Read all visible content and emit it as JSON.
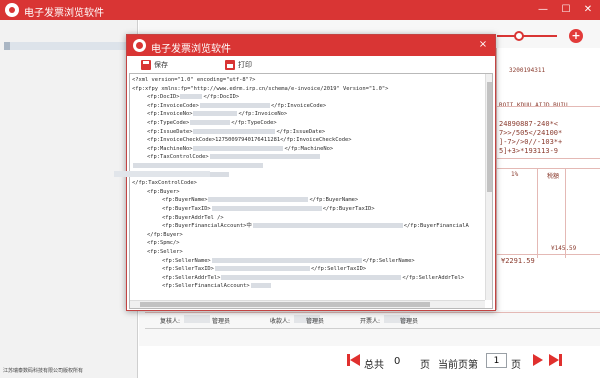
{
  "app": {
    "title": "电子发票浏览软件",
    "footer": "江苏瑞泰数码科技有限公司版权所有"
  },
  "window_controls": {
    "minimize": "—",
    "maximize": "☐",
    "close": "✕"
  },
  "zoom": {
    "plus": "+"
  },
  "invoice": {
    "lines": [
      "3200194311",
      "ROII KDUU AIJD BUIU",
      "24890887-240*<",
      "7>>/505</24100*",
      "]-7>/>0//-103*+",
      "5]+3>*193113-9",
      "",
      "¥145.59",
      "¥2291.59"
    ],
    "col_labels": [
      "1%",
      "税額"
    ]
  },
  "bottom_cells": [
    {
      "label": "复核人:",
      "value": "管理员"
    },
    {
      "label": "收款人:",
      "value": "管理员"
    },
    {
      "label": "开票人:",
      "value": "管理员"
    }
  ],
  "pager": {
    "total_label": "总共",
    "total": "0",
    "page_unit": "页",
    "current_label": "当前页第",
    "current_page": "1",
    "current_unit": "页"
  },
  "dialog": {
    "title": "电子发票浏览软件",
    "close": "×",
    "toolbar": {
      "save": "保存",
      "print": "打印"
    },
    "xml_lines": [
      {
        "indent": 0,
        "text": "<?xml version=\"1.0\" encoding=\"utf-8\"?>"
      },
      {
        "indent": 0,
        "text": "<fp:xfpy xmlns:fp=\"http://www.edrm.irp.cn/schema/e-invoice/2019\" Version=\"1.0\">"
      },
      {
        "indent": 1,
        "text": "<fp:DocID>",
        "tail": "</fp:DocID>",
        "blur": 22
      },
      {
        "indent": 1,
        "text": "<fp:InvoiceCode>",
        "tail": "</fp:InvoiceCode>",
        "blur": 70
      },
      {
        "indent": 1,
        "text": "<fp:InvoiceNo>",
        "tail": "</fp:InvoiceNo>",
        "blur": 44
      },
      {
        "indent": 1,
        "text": "<fp:TypeCode>",
        "tail": "</fp:TypeCode>",
        "blur": 40
      },
      {
        "indent": 1,
        "text": "<fp:IssueDate>",
        "tail": "</fp:IssueDate>",
        "blur": 82
      },
      {
        "indent": 1,
        "text": "<fp:InvoiceCheckCode>12750097940176411281</fp:InvoiceCheckCode>"
      },
      {
        "indent": 1,
        "text": "<fp:MachineNo>",
        "tail": "</fp:MachineNo>",
        "blur": 90
      },
      {
        "indent": 1,
        "text": "<fp:TaxControlCode>",
        "tail": "",
        "blur": 110
      },
      {
        "indent": 0,
        "text": "",
        "tail": "",
        "blur": 130
      },
      {
        "indent": 0,
        "text": "",
        "tail": "",
        "blur": 96
      },
      {
        "indent": 0,
        "text": "</fp:TaxControlCode>"
      },
      {
        "indent": 1,
        "text": "<fp:Buyer>"
      },
      {
        "indent": 2,
        "text": "<fp:BuyerName>",
        "tail": "</fp:BuyerName>",
        "blur": 100
      },
      {
        "indent": 2,
        "text": "<fp:BuyerTaxID>",
        "tail": "</fp:BuyerTaxID>",
        "blur": 110
      },
      {
        "indent": 2,
        "text": "<fp:BuyerAddrTel />"
      },
      {
        "indent": 2,
        "text": "<fp:BuyerFinancialAccount>中",
        "tail": "</fp:BuyerFinancialA",
        "blur": 150
      },
      {
        "indent": 1,
        "text": "</fp:Buyer>"
      },
      {
        "indent": 1,
        "text": "<fp:Spmc/>"
      },
      {
        "indent": 1,
        "text": "<fp:Seller>"
      },
      {
        "indent": 2,
        "text": "<fp:SellerName>",
        "tail": "</fp:SellerName>",
        "blur": 150
      },
      {
        "indent": 2,
        "text": "<fp:SellerTaxID>",
        "tail": "</fp:SellerTaxID>",
        "blur": 95
      },
      {
        "indent": 2,
        "text": "<fp:SellerAddrTel>",
        "tail": "</fp:SellerAddrTel>",
        "blur": 180
      },
      {
        "indent": 2,
        "text": "<fp:SellerFinancialAccount>",
        "tail": "",
        "blur": 20
      }
    ]
  }
}
